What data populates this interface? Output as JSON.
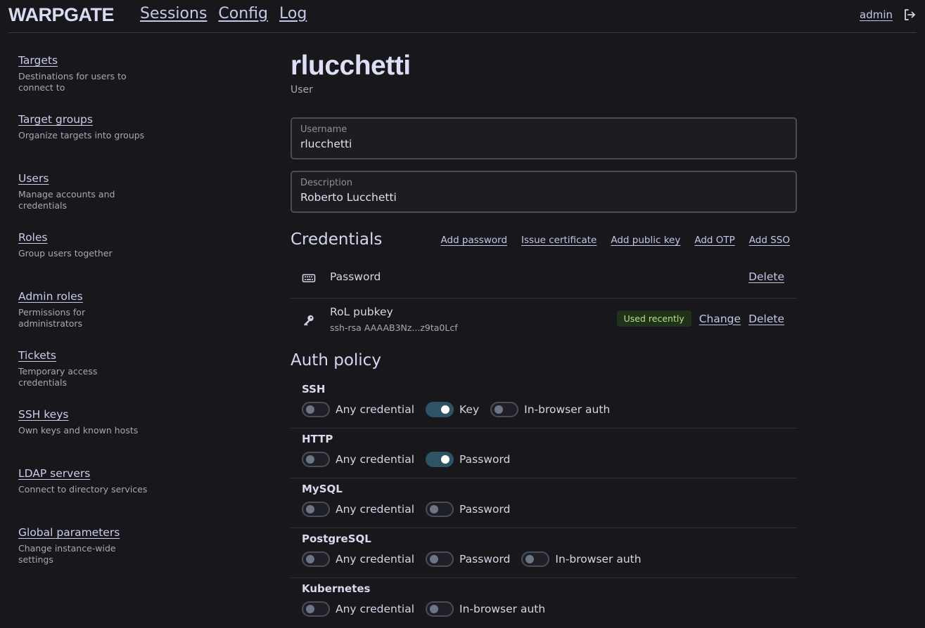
{
  "header": {
    "logo": "WARPGATE",
    "nav": [
      "Sessions",
      "Config",
      "Log"
    ],
    "username": "admin",
    "logout_icon": "logout-icon"
  },
  "sidebar": {
    "items": [
      {
        "label": "Targets",
        "desc": "Destinations for users to connect to"
      },
      {
        "label": "Target groups",
        "desc": "Organize targets into groups"
      },
      {
        "label": "Users",
        "desc": "Manage accounts and credentials"
      },
      {
        "label": "Roles",
        "desc": "Group users together"
      },
      {
        "label": "Admin roles",
        "desc": "Permissions for administrators"
      },
      {
        "label": "Tickets",
        "desc": "Temporary access credentials"
      },
      {
        "label": "SSH keys",
        "desc": "Own keys and known hosts"
      },
      {
        "label": "LDAP servers",
        "desc": "Connect to directory services"
      },
      {
        "label": "Global parameters",
        "desc": "Change instance-wide settings"
      }
    ]
  },
  "main": {
    "title": "rlucchetti",
    "subtitle": "User",
    "username_label": "Username",
    "username_value": "rlucchetti",
    "description_label": "Description",
    "description_value": "Roberto Lucchetti",
    "credentials_title": "Credentials",
    "credential_actions": [
      "Add password",
      "Issue certificate",
      "Add public key",
      "Add OTP",
      "Add SSO"
    ],
    "credentials": [
      {
        "icon": "keyboard-icon",
        "name": "Password",
        "delete": "Delete"
      },
      {
        "icon": "key-icon",
        "name": "RoL pubkey",
        "detail": "ssh-rsa AAAAB3Nz...z9ta0Lcf",
        "badge": "Used recently",
        "change": "Change",
        "delete": "Delete"
      }
    ],
    "auth_title": "Auth policy",
    "policies": [
      {
        "name": "SSH",
        "options": [
          {
            "label": "Any credential",
            "on": false
          },
          {
            "label": "Key",
            "on": true
          },
          {
            "label": "In-browser auth",
            "on": false
          }
        ]
      },
      {
        "name": "HTTP",
        "options": [
          {
            "label": "Any credential",
            "on": false
          },
          {
            "label": "Password",
            "on": true
          }
        ]
      },
      {
        "name": "MySQL",
        "options": [
          {
            "label": "Any credential",
            "on": false
          },
          {
            "label": "Password",
            "on": false
          }
        ]
      },
      {
        "name": "PostgreSQL",
        "options": [
          {
            "label": "Any credential",
            "on": false
          },
          {
            "label": "Password",
            "on": false
          },
          {
            "label": "In-browser auth",
            "on": false
          }
        ]
      },
      {
        "name": "Kubernetes",
        "options": [
          {
            "label": "Any credential",
            "on": false
          },
          {
            "label": "In-browser auth",
            "on": false
          }
        ]
      }
    ]
  },
  "colors": {
    "background": "#18181c",
    "toggle_on": "#2d5364",
    "badge_bg": "#20321a",
    "badge_text": "#b8e08a"
  }
}
